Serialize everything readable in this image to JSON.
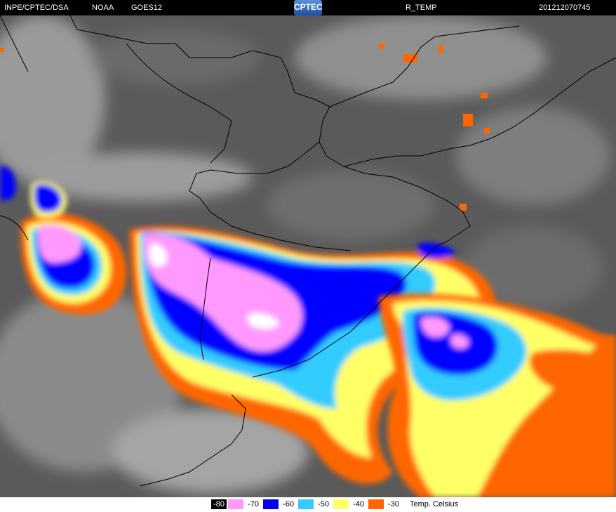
{
  "header": {
    "source": "INPE/CPTEC/DSA",
    "agency": "NOAA",
    "satellite": "GOES12",
    "logo": "CPTEC",
    "product": "R_TEMP",
    "timestamp": "201212070745"
  },
  "legend": {
    "items": [
      {
        "label": "-80",
        "color": "#000000"
      },
      {
        "label": "-70",
        "color": "#ff99ff"
      },
      {
        "label": "-60",
        "color": "#0000ff"
      },
      {
        "label": "-50",
        "color": "#33ccff"
      },
      {
        "label": "-40",
        "color": "#ffff66"
      },
      {
        "label": "-30",
        "color": "#ff6600"
      }
    ],
    "unit": "Temp. Celsius"
  },
  "colors": {
    "cloud_grey": "#5a5a5a",
    "light_cloud": "#8c8c8c",
    "bright_cloud": "#b5b5b5",
    "border_line": "#000000"
  }
}
